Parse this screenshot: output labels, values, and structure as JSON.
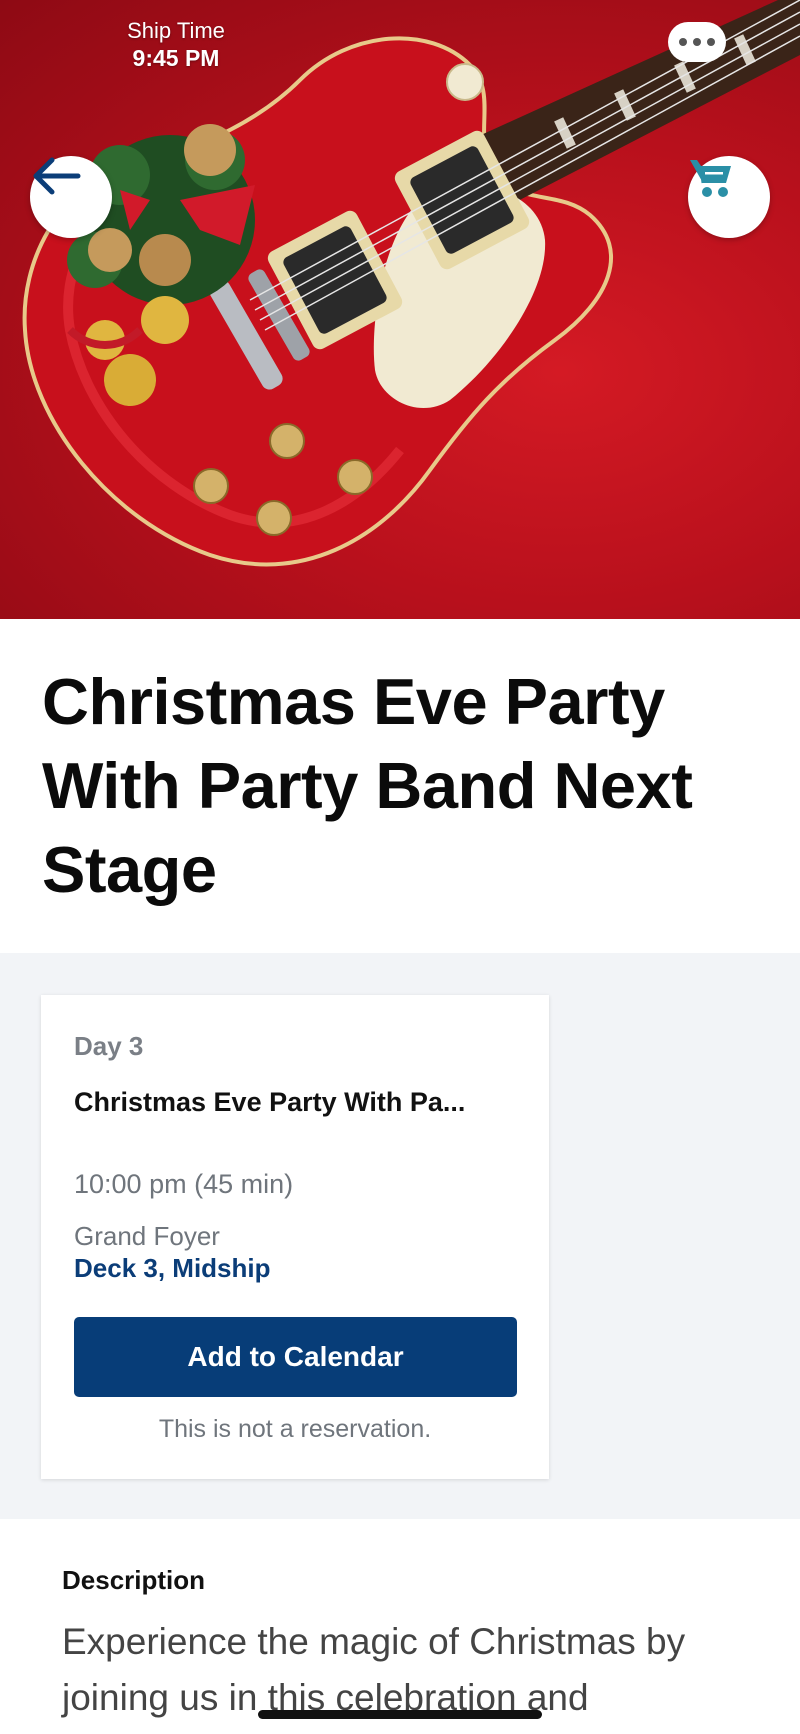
{
  "status": {
    "ship_time_label": "Ship Time",
    "ship_time_value": "9:45 PM"
  },
  "header": {
    "back_icon": "arrow-left-icon",
    "cart_icon": "shopping-cart-icon",
    "chat_icon": "chat-bubble-icon"
  },
  "event": {
    "title": "Christmas Eve Party With Party Band Next Stage"
  },
  "card": {
    "day": "Day 3",
    "event_name": "Christmas Eve Party With Pa...",
    "time": "10:00 pm (45 min)",
    "venue": "Grand Foyer",
    "deck": "Deck 3, Midship",
    "add_calendar_label": "Add to Calendar",
    "note": "This is not a reservation."
  },
  "description": {
    "heading": "Description",
    "body": "Experience the magic of Christmas by joining us in this celebration and"
  },
  "colors": {
    "primary": "#073d78",
    "deck_link": "#0b3d78",
    "cart_accent": "#2a8fa6",
    "band": "#f2f4f7"
  }
}
